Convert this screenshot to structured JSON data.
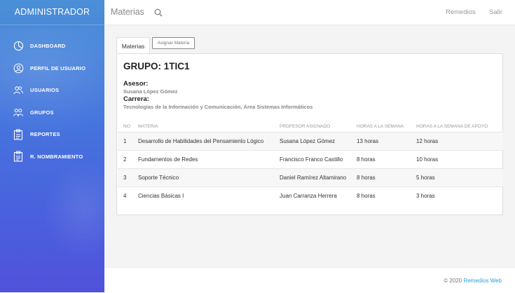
{
  "sidebar": {
    "brand": "ADMINISTRADOR",
    "items": [
      {
        "label": "DASHBOARD",
        "icon": "dashboard-icon"
      },
      {
        "label": "PERFIL DE USUARIO",
        "icon": "user-profile-icon"
      },
      {
        "label": "USUARIOS",
        "icon": "users-icon"
      },
      {
        "label": "GRUPOS",
        "icon": "groups-icon"
      },
      {
        "label": "REPORTES",
        "icon": "reports-icon"
      },
      {
        "label": "R. NOMBRAMIENTO",
        "icon": "appointment-icon"
      }
    ]
  },
  "header": {
    "title": "Materias",
    "user": "Remedios",
    "logout": "Salir"
  },
  "tabs": {
    "active": "Materias",
    "assign_button": "Asignar Materia"
  },
  "group": {
    "title": "GRUPO: 1TIC1",
    "advisor_label": "Asesor:",
    "advisor_name": "Susana López Gómez",
    "career_label": "Carrera:",
    "career_name": "Tecnologías de la Información y Comunicación, Área Sistemas Informáticos"
  },
  "table": {
    "headers": [
      "NO",
      "MATERIA",
      "PROFESOR ASIGNADO",
      "HORAS A LA SEMANA",
      "HORAS A LA SEMANA DE APOYO"
    ],
    "rows": [
      [
        "1",
        "Desarrollo de Habilidades del Pensamiento Lógico",
        "Susana López Gómez",
        "13 horas",
        "12 horas"
      ],
      [
        "2",
        "Fundamentos de Redes",
        "Francisco Franco Castillo",
        "8 horas",
        "10 horas"
      ],
      [
        "3",
        "Soporte Técnico",
        "Daniel Ramírez Altamirano",
        "8 horas",
        "5 horas"
      ],
      [
        "4",
        "Ciencias Básicas I",
        "Juan Carranza Herrera",
        "8 horas",
        "3 horas"
      ]
    ]
  },
  "footer": {
    "copyright": "© 2020 ",
    "link": "Remedios Web"
  },
  "colors": {
    "sidebar_top": "#4a8fd8",
    "sidebar_bottom": "#5152dc",
    "link": "#2aa0d8"
  }
}
